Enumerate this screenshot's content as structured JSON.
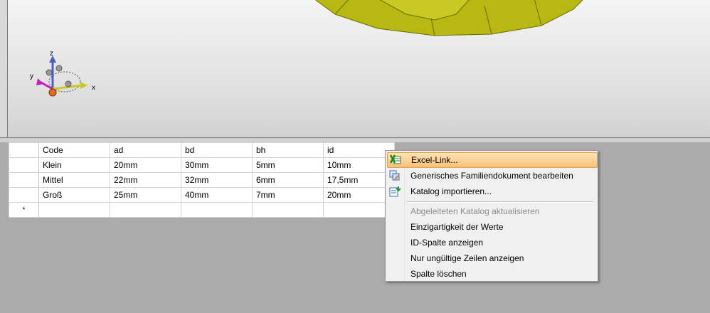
{
  "viewport": {
    "axis_x": "x",
    "axis_y": "y",
    "axis_z": "z",
    "model_color": "#b8b812"
  },
  "table": {
    "headers": [
      "Code",
      "ad",
      "bd",
      "bh",
      "id"
    ],
    "rows": [
      [
        "Klein",
        "20mm",
        "30mm",
        "5mm",
        "10mm"
      ],
      [
        "Mittel",
        "22mm",
        "32mm",
        "6mm",
        "17,5mm"
      ],
      [
        "Groß",
        "25mm",
        "40mm",
        "7mm",
        "20mm"
      ]
    ],
    "new_row_marker": "*"
  },
  "context_menu": {
    "items": [
      {
        "label": "Excel-Link...",
        "icon": "excel-icon"
      },
      {
        "label": "Generisches Familiendokument bearbeiten",
        "icon": "edit-family-icon"
      },
      {
        "label": "Katalog importieren...",
        "icon": "import-catalog-icon"
      },
      {
        "label": "Abgeleiteten Katalog aktualisieren"
      },
      {
        "label": "Einzigartigkeit der Werte"
      },
      {
        "label": "ID-Spalte anzeigen"
      },
      {
        "label": "Nur ungültige Zeilen anzeigen"
      },
      {
        "label": "Spalte löschen"
      }
    ]
  }
}
